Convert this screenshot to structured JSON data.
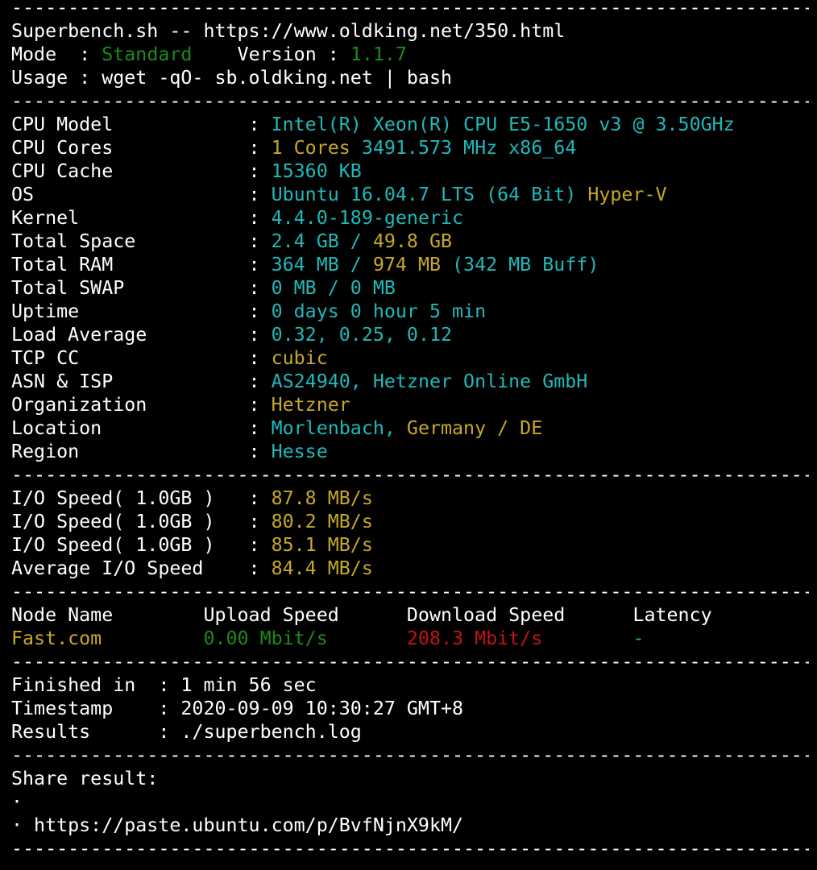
{
  "colors": {
    "background": "#000000",
    "text": "#ffffff",
    "green": "#1b8a1b",
    "cyan": "#1fb9b9",
    "yellow": "#c6a826",
    "red": "#c11414"
  },
  "separator": "-----------------------------------------------------------------------",
  "lines": [
    {
      "type": "sep"
    },
    {
      "type": "text",
      "segments": [
        {
          "text": "Superbench.sh -- https://www.oldking.net/350.html",
          "color": "white"
        }
      ]
    },
    {
      "type": "text",
      "segments": [
        {
          "text": "Mode  : ",
          "color": "white"
        },
        {
          "text": "Standard",
          "color": "green"
        },
        {
          "text": "    Version : ",
          "color": "white"
        },
        {
          "text": "1.1.7",
          "color": "green"
        }
      ]
    },
    {
      "type": "text",
      "segments": [
        {
          "text": "Usage : wget -qO- sb.oldking.net | bash",
          "color": "white"
        }
      ]
    },
    {
      "type": "sep"
    },
    {
      "type": "text",
      "segments": [
        {
          "text": "CPU Model            : ",
          "color": "white"
        },
        {
          "text": "Intel(R) Xeon(R) CPU E5-1650 v3 @ 3.50GHz",
          "color": "cyan"
        }
      ]
    },
    {
      "type": "text",
      "segments": [
        {
          "text": "CPU Cores            : ",
          "color": "white"
        },
        {
          "text": "1 Cores ",
          "color": "yellow"
        },
        {
          "text": "3491.573 MHz x86_64",
          "color": "cyan"
        }
      ]
    },
    {
      "type": "text",
      "segments": [
        {
          "text": "CPU Cache            : ",
          "color": "white"
        },
        {
          "text": "15360 KB",
          "color": "cyan"
        }
      ]
    },
    {
      "type": "text",
      "segments": [
        {
          "text": "OS                   : ",
          "color": "white"
        },
        {
          "text": "Ubuntu 16.04.7 LTS (64 Bit) ",
          "color": "cyan"
        },
        {
          "text": "Hyper-V",
          "color": "yellow"
        }
      ]
    },
    {
      "type": "text",
      "segments": [
        {
          "text": "Kernel               : ",
          "color": "white"
        },
        {
          "text": "4.4.0-189-generic",
          "color": "cyan"
        }
      ]
    },
    {
      "type": "text",
      "segments": [
        {
          "text": "Total Space          : ",
          "color": "white"
        },
        {
          "text": "2.4 GB / ",
          "color": "cyan"
        },
        {
          "text": "49.8 GB",
          "color": "yellow"
        }
      ]
    },
    {
      "type": "text",
      "segments": [
        {
          "text": "Total RAM            : ",
          "color": "white"
        },
        {
          "text": "364 MB / ",
          "color": "cyan"
        },
        {
          "text": "974 MB ",
          "color": "yellow"
        },
        {
          "text": "(342 MB Buff)",
          "color": "cyan"
        }
      ]
    },
    {
      "type": "text",
      "segments": [
        {
          "text": "Total SWAP           : ",
          "color": "white"
        },
        {
          "text": "0 MB / 0 MB",
          "color": "cyan"
        }
      ]
    },
    {
      "type": "text",
      "segments": [
        {
          "text": "Uptime               : ",
          "color": "white"
        },
        {
          "text": "0 days 0 hour 5 min",
          "color": "cyan"
        }
      ]
    },
    {
      "type": "text",
      "segments": [
        {
          "text": "Load Average         : ",
          "color": "white"
        },
        {
          "text": "0.32, 0.25, 0.12",
          "color": "cyan"
        }
      ]
    },
    {
      "type": "text",
      "segments": [
        {
          "text": "TCP CC               : ",
          "color": "white"
        },
        {
          "text": "cubic",
          "color": "yellow"
        }
      ]
    },
    {
      "type": "text",
      "segments": [
        {
          "text": "ASN & ISP            : ",
          "color": "white"
        },
        {
          "text": "AS24940, Hetzner Online GmbH",
          "color": "cyan"
        }
      ]
    },
    {
      "type": "text",
      "segments": [
        {
          "text": "Organization         : ",
          "color": "white"
        },
        {
          "text": "Hetzner",
          "color": "yellow"
        }
      ]
    },
    {
      "type": "text",
      "segments": [
        {
          "text": "Location             : ",
          "color": "white"
        },
        {
          "text": "Morlenbach, ",
          "color": "cyan"
        },
        {
          "text": "Germany / DE",
          "color": "yellow"
        }
      ]
    },
    {
      "type": "text",
      "segments": [
        {
          "text": "Region               : ",
          "color": "white"
        },
        {
          "text": "Hesse",
          "color": "cyan"
        }
      ]
    },
    {
      "type": "sep"
    },
    {
      "type": "text",
      "segments": [
        {
          "text": "I/O Speed( 1.0GB )   : ",
          "color": "white"
        },
        {
          "text": "87.8 MB/s",
          "color": "yellow"
        }
      ]
    },
    {
      "type": "text",
      "segments": [
        {
          "text": "I/O Speed( 1.0GB )   : ",
          "color": "white"
        },
        {
          "text": "80.2 MB/s",
          "color": "yellow"
        }
      ]
    },
    {
      "type": "text",
      "segments": [
        {
          "text": "I/O Speed( 1.0GB )   : ",
          "color": "white"
        },
        {
          "text": "85.1 MB/s",
          "color": "yellow"
        }
      ]
    },
    {
      "type": "text",
      "segments": [
        {
          "text": "Average I/O Speed    : ",
          "color": "white"
        },
        {
          "text": "84.4 MB/s",
          "color": "yellow"
        }
      ]
    },
    {
      "type": "sep"
    },
    {
      "type": "text",
      "segments": [
        {
          "text": "Node Name        Upload Speed      Download Speed      Latency",
          "color": "white"
        }
      ]
    },
    {
      "type": "text",
      "segments": [
        {
          "text": "Fast.com         ",
          "color": "yellow"
        },
        {
          "text": "0.00 Mbit/s       ",
          "color": "green"
        },
        {
          "text": "208.3 Mbit/s        ",
          "color": "red"
        },
        {
          "text": "-",
          "color": "cyan"
        }
      ]
    },
    {
      "type": "sep"
    },
    {
      "type": "text",
      "segments": [
        {
          "text": "Finished in  : 1 min 56 sec",
          "color": "white"
        }
      ]
    },
    {
      "type": "text",
      "segments": [
        {
          "text": "Timestamp    : 2020-09-09 10:30:27 GMT+8",
          "color": "white"
        }
      ]
    },
    {
      "type": "text",
      "segments": [
        {
          "text": "Results      : ./superbench.log",
          "color": "white"
        }
      ]
    },
    {
      "type": "sep"
    },
    {
      "type": "text",
      "segments": [
        {
          "text": "Share result:",
          "color": "white"
        }
      ]
    },
    {
      "type": "text",
      "segments": [
        {
          "text": "·",
          "color": "white"
        }
      ]
    },
    {
      "type": "text",
      "segments": [
        {
          "text": "· https://paste.ubuntu.com/p/BvfNjnX9kM/",
          "color": "white"
        }
      ]
    },
    {
      "type": "sep"
    }
  ]
}
